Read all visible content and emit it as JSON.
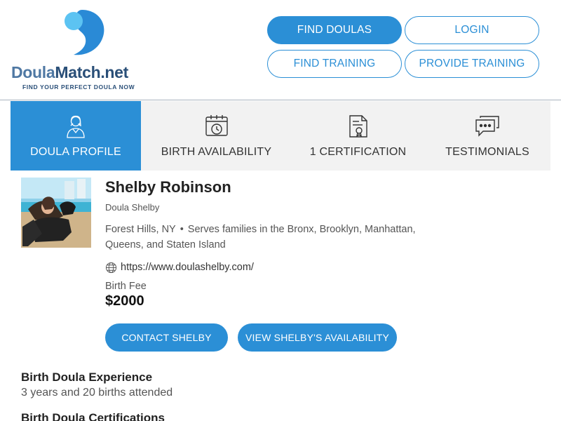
{
  "brand": {
    "name_part1": "Doula",
    "name_part2": "Match.net",
    "tagline": "FIND YOUR PERFECT DOULA NOW",
    "colors": {
      "accent": "#2b8fd6",
      "logo_light": "#5cc3f2",
      "logo_dark": "#2a8ad6",
      "text_dark": "#2a4f78"
    }
  },
  "nav": {
    "find_doulas": "FIND DOULAS",
    "login": "LOGIN",
    "find_training": "FIND TRAINING",
    "provide_training": "PROVIDE TRAINING"
  },
  "tabs": [
    {
      "label": "DOULA PROFILE",
      "icon": "person-icon",
      "active": true
    },
    {
      "label": "BIRTH AVAILABILITY",
      "icon": "calendar-clock-icon",
      "active": false
    },
    {
      "label": "1 CERTIFICATION",
      "icon": "certificate-document-icon",
      "active": false
    },
    {
      "label": "TESTIMONIALS",
      "icon": "chat-bubbles-icon",
      "active": false
    }
  ],
  "profile": {
    "name": "Shelby Robinson",
    "business": "Doula Shelby",
    "location": "Forest Hills, NY",
    "serves": "Serves families in the Bronx, Brooklyn, Manhattan, Queens, and Staten Island",
    "website": "https://www.doulashelby.com/",
    "fee_label": "Birth Fee",
    "fee": "$2000",
    "contact_button": "CONTACT SHELBY",
    "availability_button": "VIEW SHELBY'S AVAILABILITY"
  },
  "sections": {
    "experience_title": "Birth Doula Experience",
    "experience_text": "3 years and 20 births attended",
    "certifications_title": "Birth Doula Certifications"
  }
}
